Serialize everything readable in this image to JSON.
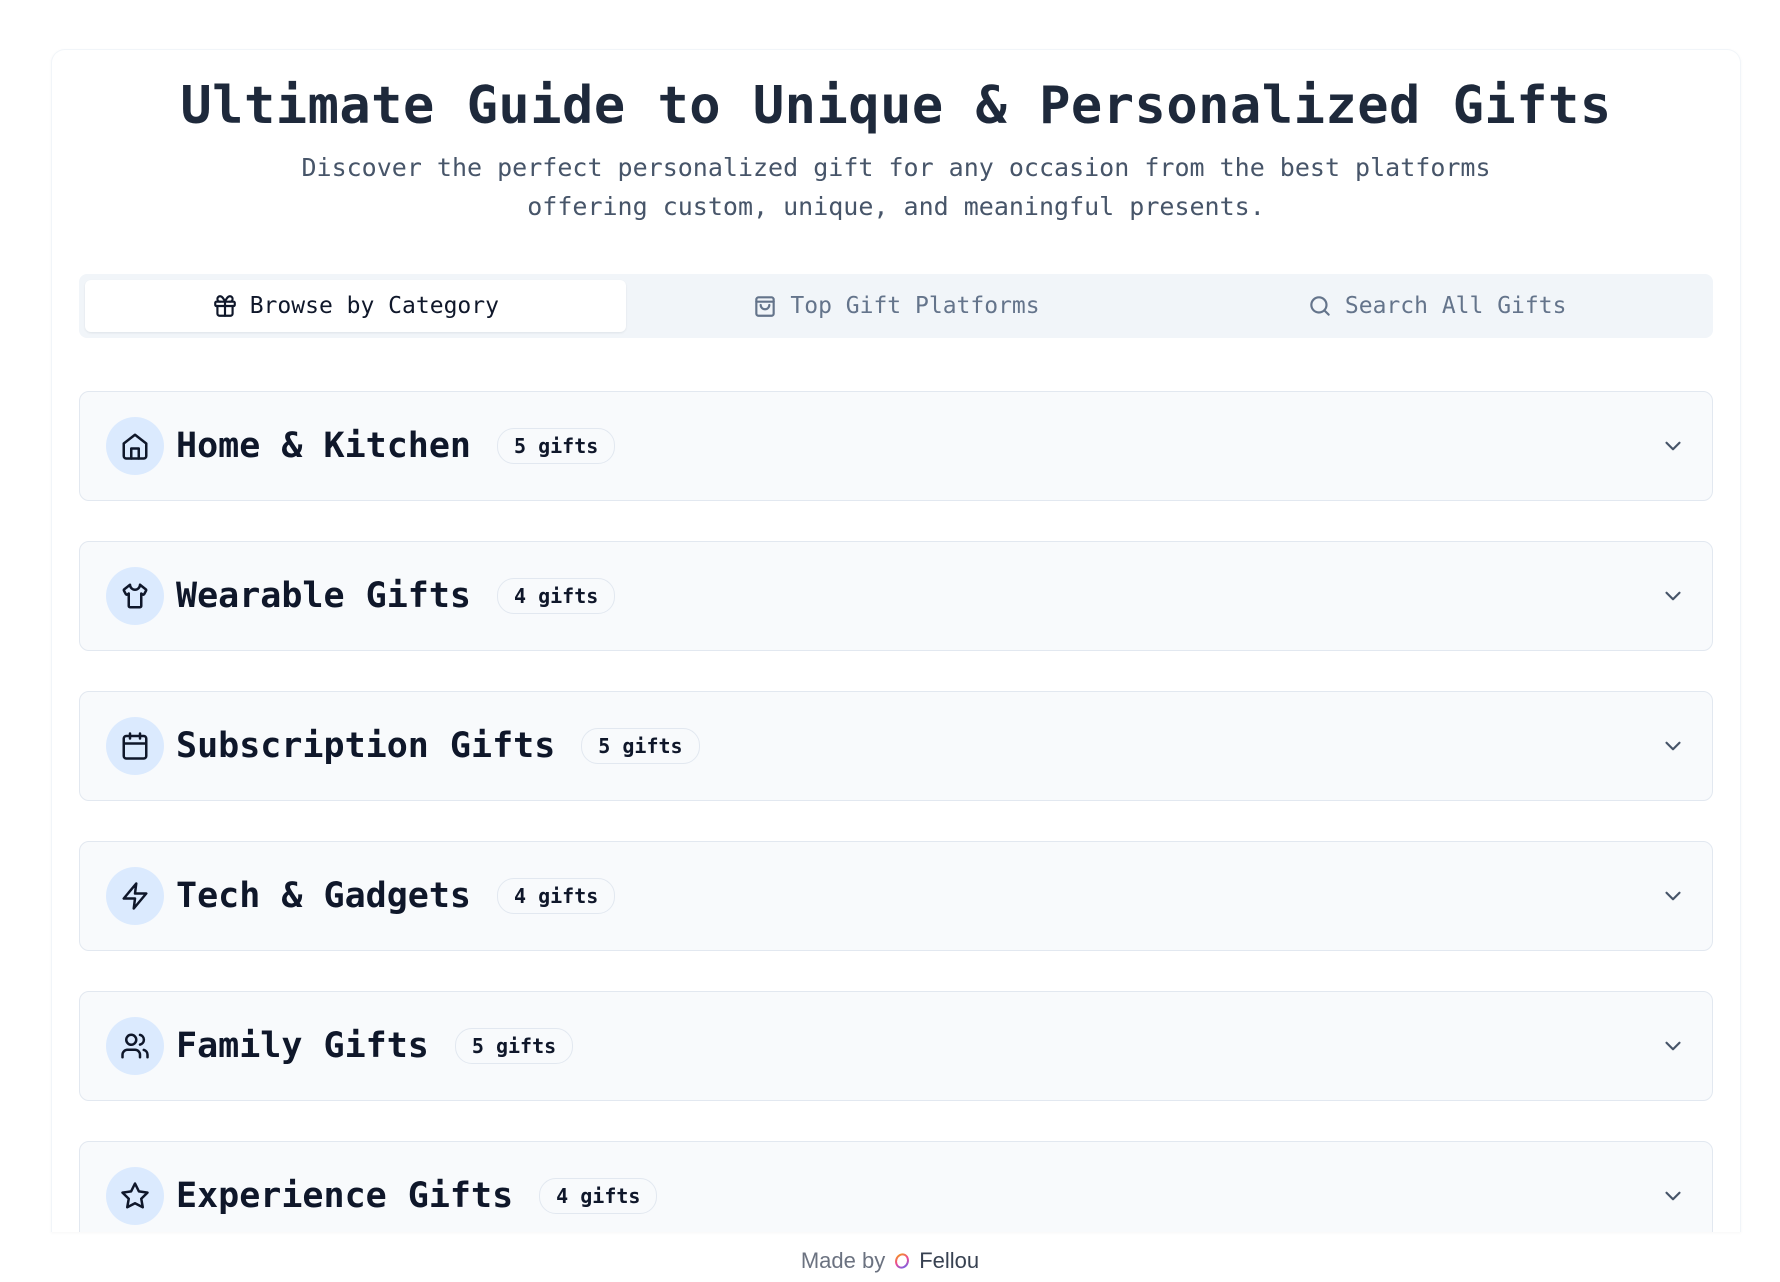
{
  "header": {
    "title": "Ultimate Guide to Unique & Personalized Gifts",
    "subtitle": "Discover the perfect personalized gift for any occasion from the best platforms offering custom, unique, and meaningful presents."
  },
  "tabs": [
    {
      "label": "Browse by Category",
      "icon": "gift-icon",
      "active": true
    },
    {
      "label": "Top Gift Platforms",
      "icon": "shopping-bag-icon",
      "active": false
    },
    {
      "label": "Search All Gifts",
      "icon": "search-icon",
      "active": false
    }
  ],
  "categories": [
    {
      "name": "Home & Kitchen",
      "count": "5 gifts",
      "icon": "home-icon"
    },
    {
      "name": "Wearable Gifts",
      "count": "4 gifts",
      "icon": "shirt-icon"
    },
    {
      "name": "Subscription Gifts",
      "count": "5 gifts",
      "icon": "calendar-icon"
    },
    {
      "name": "Tech & Gadgets",
      "count": "4 gifts",
      "icon": "lightning-icon"
    },
    {
      "name": "Family Gifts",
      "count": "5 gifts",
      "icon": "users-icon"
    },
    {
      "name": "Experience Gifts",
      "count": "4 gifts",
      "icon": "star-icon"
    }
  ],
  "footer": {
    "made_by": "Made by",
    "brand": "Fellou"
  },
  "colors": {
    "accent_circle": "#dbeafe",
    "tab_bar": "#f1f5f9",
    "card_bg": "#f8fafc"
  }
}
